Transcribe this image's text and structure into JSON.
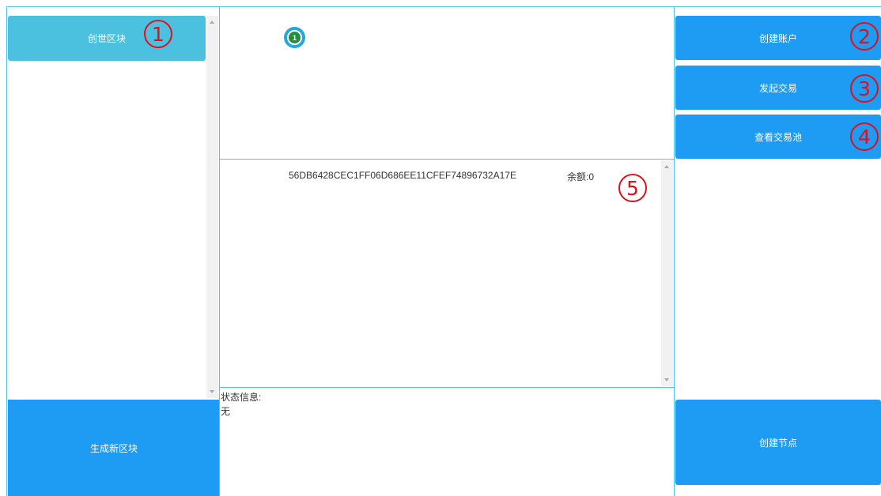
{
  "left": {
    "genesis_label": "创世区块",
    "new_block_label": "生成新区块"
  },
  "center": {
    "node_badge": "1",
    "account_address": "56DB6428CEC1FF06D686EE11CFEF74896732A17E",
    "balance_label": "余额:0",
    "status_label": "状态信息:",
    "status_value": "无"
  },
  "right": {
    "create_account_label": "创建账户",
    "send_tx_label": "发起交易",
    "view_pool_label": "查看交易池",
    "create_node_label": "创建节点"
  },
  "annotations": [
    "1",
    "2",
    "3",
    "4",
    "5"
  ],
  "colors": {
    "primary_button": "#1e9bf2",
    "genesis_button": "#4cc1df",
    "panel_border": "#4fc3e6",
    "annotation_red": "#e0101a",
    "node_green": "#1f8e3d"
  }
}
